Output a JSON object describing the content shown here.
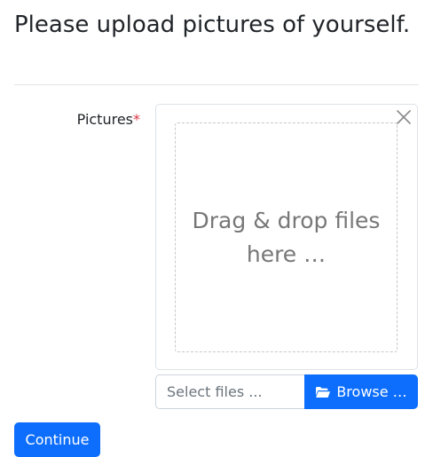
{
  "page": {
    "title": "Please upload pictures of yourself."
  },
  "form": {
    "pictures_label": "Pictures",
    "required_marker": "*",
    "drop_zone_text": "Drag & drop files here …",
    "file_caption_placeholder": "Select files ...",
    "browse_label": "Browse …",
    "continue_label": "Continue"
  },
  "icons": {
    "close": "close-icon",
    "browse": "folder-open-icon"
  },
  "colors": {
    "primary": "#0d6efd",
    "required": "#dc3545",
    "drop_text": "#777777",
    "border": "#dee2e6"
  }
}
